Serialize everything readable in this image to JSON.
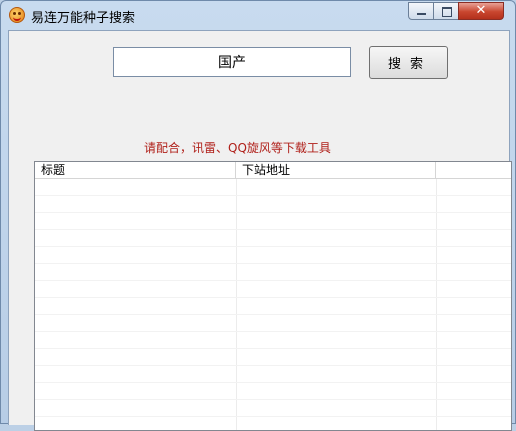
{
  "window": {
    "title": "易连万能种子搜索",
    "app_icon": "smiley-face-icon",
    "close_glyph": "✕"
  },
  "search": {
    "value": "国产",
    "button_label": "搜索"
  },
  "hint": "请配合，讯雷、QQ旋风等下载工具",
  "table": {
    "columns": [
      "标题",
      "下站地址",
      ""
    ],
    "rows": []
  },
  "colors": {
    "hint_text": "#b0201a",
    "close_button": "#c9462f"
  }
}
